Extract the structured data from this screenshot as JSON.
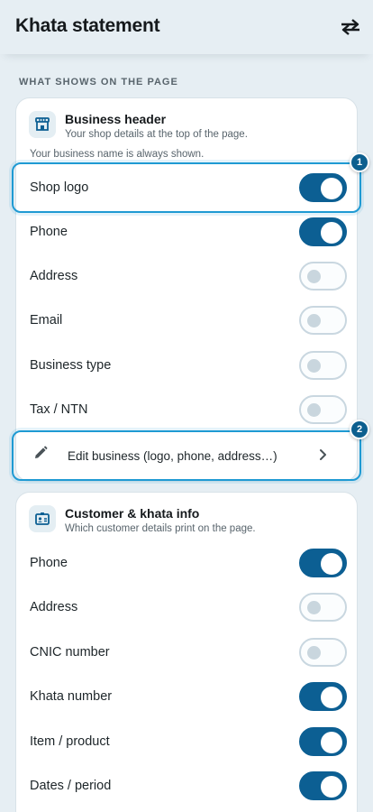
{
  "header": {
    "title": "Khata statement",
    "action_icon": "swap-arrows-icon"
  },
  "section_label": "WHAT SHOWS ON THE PAGE",
  "business_card": {
    "title": "Business header",
    "subtitle": "Your shop details at the top of the page.",
    "note": "Your business name is always shown.",
    "icon": "storefront-icon",
    "rows": [
      {
        "label": "Shop logo",
        "on": true
      },
      {
        "label": "Phone",
        "on": true
      },
      {
        "label": "Address",
        "on": false
      },
      {
        "label": "Email",
        "on": false
      },
      {
        "label": "Business type",
        "on": false
      },
      {
        "label": "Tax / NTN",
        "on": false
      }
    ],
    "edit_link": "Edit business (logo, phone, address…)"
  },
  "customer_card": {
    "title": "Customer & khata info",
    "subtitle": "Which customer details print on the page.",
    "icon": "id-card-icon",
    "rows": [
      {
        "label": "Phone",
        "on": true
      },
      {
        "label": "Address",
        "on": false
      },
      {
        "label": "CNIC number",
        "on": false
      },
      {
        "label": "Khata number",
        "on": true
      },
      {
        "label": "Item / product",
        "on": true
      },
      {
        "label": "Dates / period",
        "on": true
      }
    ]
  },
  "callouts": [
    "1",
    "2"
  ],
  "colors": {
    "accent": "#0c5f93",
    "highlight": "#1f9ad3",
    "background": "#e6eef3"
  }
}
